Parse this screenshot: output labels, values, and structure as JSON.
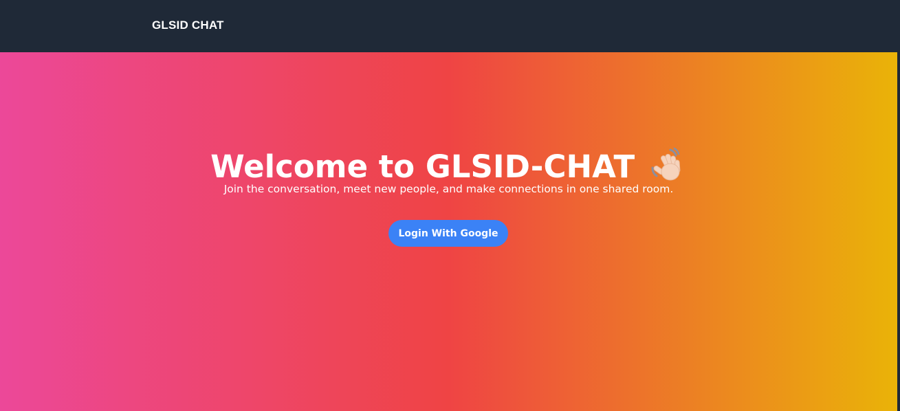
{
  "navbar": {
    "brand": "GLSID CHAT"
  },
  "hero": {
    "title": "Welcome to GLSID-CHAT",
    "title_icon": "waving-hand-icon",
    "subtitle": "Join the conversation, meet new people, and make connections in one shared room.",
    "login_button_label": "Login With Google"
  },
  "colors": {
    "navbar_bg": "#1f2937",
    "gradient_start": "#ec4899",
    "gradient_mid": "#ef4444",
    "gradient_end": "#eab308",
    "button_bg": "#3b82f6",
    "text": "#ffffff"
  }
}
